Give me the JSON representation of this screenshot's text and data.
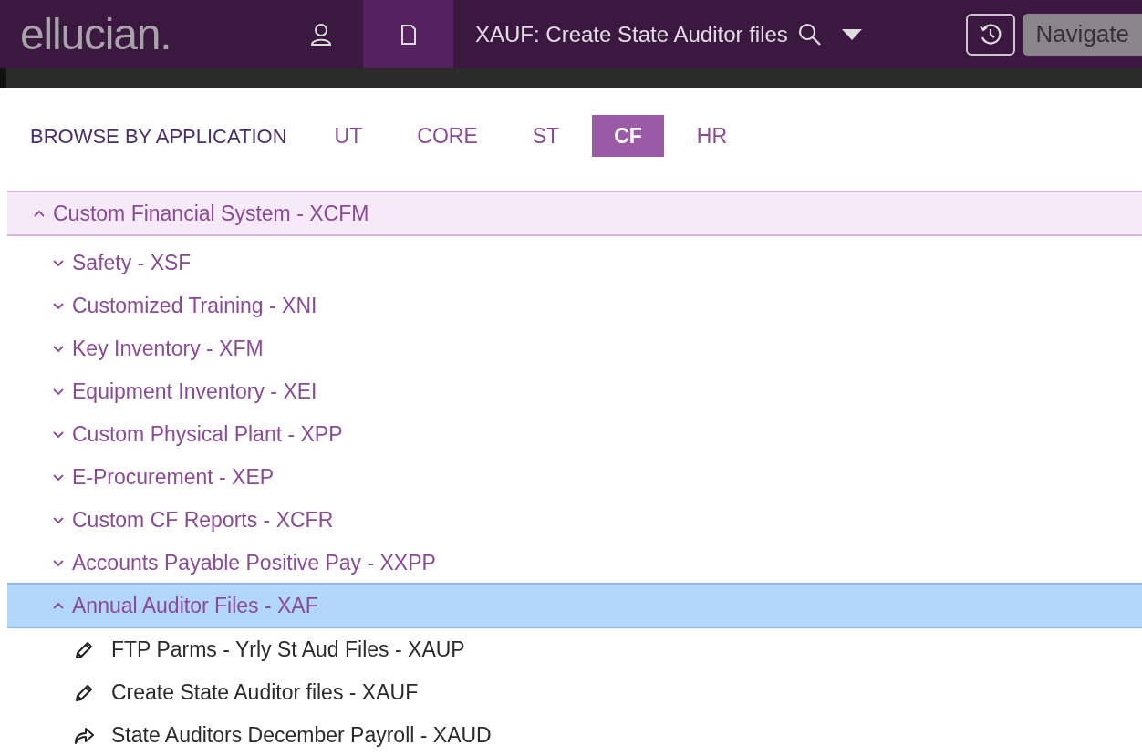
{
  "header": {
    "logo": "ellucian.",
    "page_title": "XAUF: Create State Auditor files",
    "navigate_button": "Navigate"
  },
  "browse": {
    "label": "BROWSE BY APPLICATION",
    "tabs": [
      {
        "label": "UT",
        "selected": false
      },
      {
        "label": "CORE",
        "selected": false
      },
      {
        "label": "ST",
        "selected": false
      },
      {
        "label": "CF",
        "selected": true
      },
      {
        "label": "HR",
        "selected": false
      }
    ]
  },
  "tree": [
    {
      "label": "Custom Financial System - XCFM",
      "kind": "group",
      "expanded": true,
      "selected": false,
      "children": [
        {
          "label": "Safety - XSF",
          "kind": "group",
          "expanded": false,
          "selected": false
        },
        {
          "label": "Customized Training - XNI",
          "kind": "group",
          "expanded": false,
          "selected": false
        },
        {
          "label": "Key Inventory - XFM",
          "kind": "group",
          "expanded": false,
          "selected": false
        },
        {
          "label": "Equipment Inventory - XEI",
          "kind": "group",
          "expanded": false,
          "selected": false
        },
        {
          "label": "Custom Physical Plant - XPP",
          "kind": "group",
          "expanded": false,
          "selected": false
        },
        {
          "label": "E-Procurement - XEP",
          "kind": "group",
          "expanded": false,
          "selected": false
        },
        {
          "label": "Custom CF Reports - XCFR",
          "kind": "group",
          "expanded": false,
          "selected": false
        },
        {
          "label": "Accounts Payable Positive Pay - XXPP",
          "kind": "group",
          "expanded": false,
          "selected": false
        },
        {
          "label": "Annual Auditor Files - XAF",
          "kind": "group",
          "expanded": true,
          "selected": true,
          "children": [
            {
              "label": "FTP Parms - Yrly St Aud Files - XAUP",
              "kind": "form"
            },
            {
              "label": "Create State Auditor files - XAUF",
              "kind": "form"
            },
            {
              "label": "State Auditors December Payroll - XAUD",
              "kind": "job"
            }
          ]
        }
      ]
    }
  ]
}
